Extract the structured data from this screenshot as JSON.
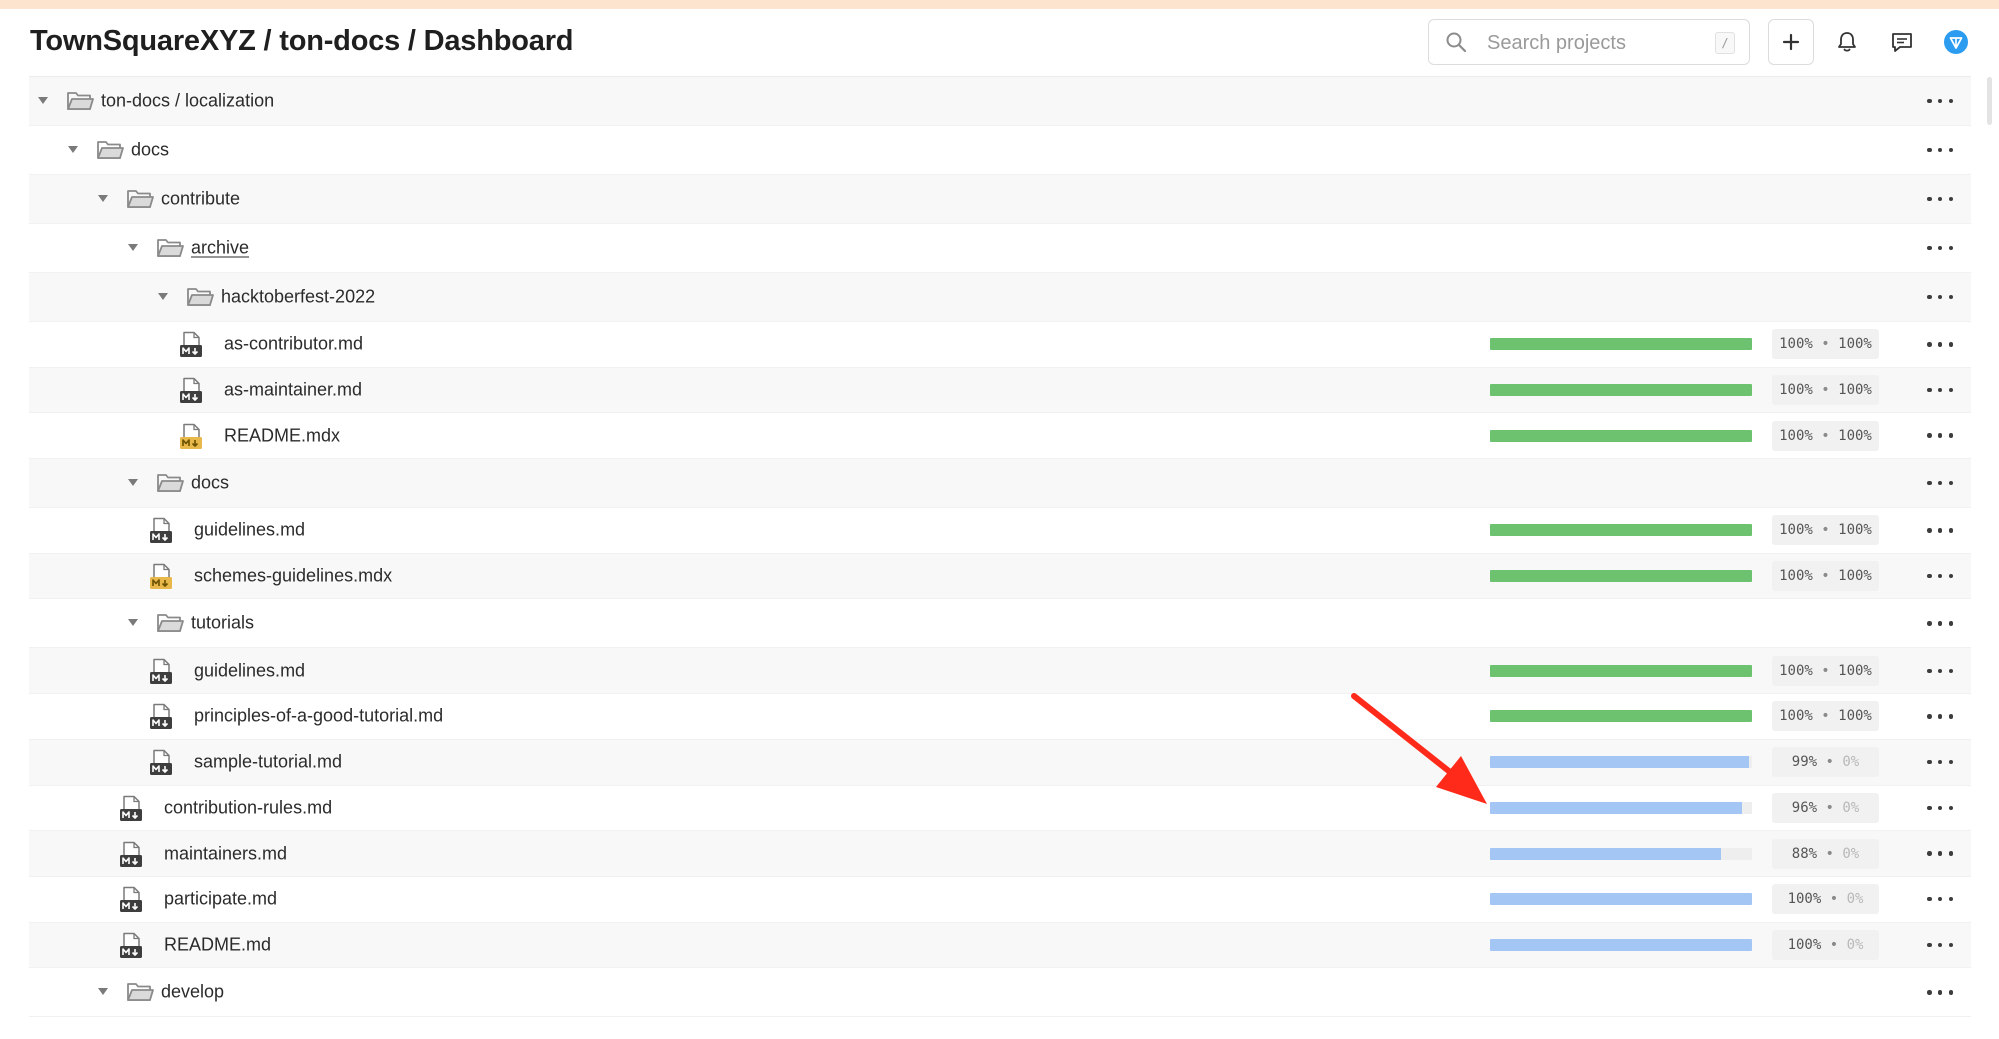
{
  "header": {
    "breadcrumb": "TownSquareXYZ / ton-docs / Dashboard",
    "search_placeholder": "Search projects",
    "search_shortcut": "/",
    "icons": [
      "plus-icon",
      "bell-icon",
      "chat-icon",
      "avatar-icon"
    ]
  },
  "colors": {
    "complete_bar": "#6cc26f",
    "partial_bar": "#a4c6f5",
    "bar_track": "#eeeeee",
    "md_icon": "#3e3e3e",
    "mdx_icon": "#e8b84b",
    "folder_icon": "#8a8a8a",
    "avatar": "#2c9cf0",
    "arrow": "#ff2a1a"
  },
  "tree": {
    "rows": [
      {
        "type": "folder",
        "depth": 0,
        "name": "ton-docs / localization",
        "expanded": true
      },
      {
        "type": "folder",
        "depth": 1,
        "name": "docs",
        "expanded": true
      },
      {
        "type": "folder",
        "depth": 2,
        "name": "contribute",
        "expanded": true
      },
      {
        "type": "folder",
        "depth": 3,
        "name": "archive",
        "expanded": true,
        "link": true
      },
      {
        "type": "folder",
        "depth": 4,
        "name": "hacktoberfest-2022",
        "expanded": true
      },
      {
        "type": "file",
        "depth": 5,
        "name": "as-contributor.md",
        "ext": "md",
        "progress": 1.0,
        "translated": "100%",
        "approved": "100%"
      },
      {
        "type": "file",
        "depth": 5,
        "name": "as-maintainer.md",
        "ext": "md",
        "progress": 1.0,
        "translated": "100%",
        "approved": "100%"
      },
      {
        "type": "file",
        "depth": 5,
        "name": "README.mdx",
        "ext": "mdx",
        "progress": 1.0,
        "translated": "100%",
        "approved": "100%"
      },
      {
        "type": "folder",
        "depth": 3,
        "name": "docs",
        "expanded": true
      },
      {
        "type": "file",
        "depth": 4,
        "name": "guidelines.md",
        "ext": "md",
        "progress": 1.0,
        "translated": "100%",
        "approved": "100%"
      },
      {
        "type": "file",
        "depth": 4,
        "name": "schemes-guidelines.mdx",
        "ext": "mdx",
        "progress": 1.0,
        "translated": "100%",
        "approved": "100%"
      },
      {
        "type": "folder",
        "depth": 3,
        "name": "tutorials",
        "expanded": true
      },
      {
        "type": "file",
        "depth": 4,
        "name": "guidelines.md",
        "ext": "md",
        "progress": 1.0,
        "translated": "100%",
        "approved": "100%"
      },
      {
        "type": "file",
        "depth": 4,
        "name": "principles-of-a-good-tutorial.md",
        "ext": "md",
        "progress": 1.0,
        "translated": "100%",
        "approved": "100%"
      },
      {
        "type": "file",
        "depth": 4,
        "name": "sample-tutorial.md",
        "ext": "md",
        "progress": 0.99,
        "translated": "99%",
        "approved": "0%"
      },
      {
        "type": "file",
        "depth": 3,
        "name": "contribution-rules.md",
        "ext": "md",
        "progress": 0.96,
        "translated": "96%",
        "approved": "0%"
      },
      {
        "type": "file",
        "depth": 3,
        "name": "maintainers.md",
        "ext": "md",
        "progress": 0.88,
        "translated": "88%",
        "approved": "0%"
      },
      {
        "type": "file",
        "depth": 3,
        "name": "participate.md",
        "ext": "md",
        "progress": 1.0,
        "translated": "100%",
        "approved": "0%"
      },
      {
        "type": "file",
        "depth": 3,
        "name": "README.md",
        "ext": "md",
        "progress": 1.0,
        "translated": "100%",
        "approved": "0%"
      },
      {
        "type": "folder",
        "depth": 2,
        "name": "develop",
        "expanded": true
      }
    ]
  }
}
